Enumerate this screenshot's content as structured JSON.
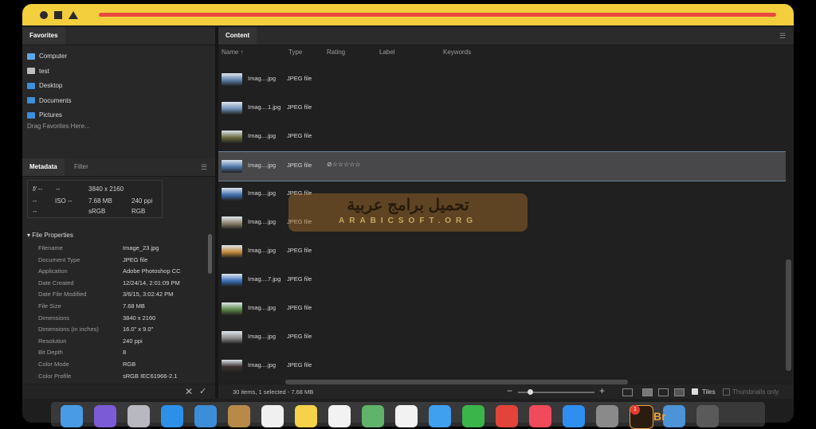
{
  "window": {
    "title_bar_color": "#f3cf3e",
    "title_line_color": "#e84a3f"
  },
  "favorites": {
    "tab": "Favorites",
    "items": [
      {
        "label": "Computer",
        "icon": "computer-icon"
      },
      {
        "label": "test",
        "icon": "home-icon"
      },
      {
        "label": "Desktop",
        "icon": "folder-icon"
      },
      {
        "label": "Documents",
        "icon": "folder-icon"
      },
      {
        "label": "Pictures",
        "icon": "folder-icon"
      }
    ],
    "drag_hint": "Drag Favorites Here..."
  },
  "metadata": {
    "tabs": [
      "Metadata",
      "Filter"
    ],
    "summary": {
      "aperture": "f/ --",
      "shutter": "--",
      "focal": "--",
      "iso": "ISO --",
      "ev": "--",
      "dims": "3840 x 2160",
      "size": "7.68 MB",
      "ppi": "240 ppi",
      "profile": "sRGB",
      "mode": "RGB"
    },
    "section_title": "File Properties",
    "properties": [
      {
        "label": "Filename",
        "value": "Image_23.jpg"
      },
      {
        "label": "Document Type",
        "value": "JPEG file"
      },
      {
        "label": "Application",
        "value": "Adobe Photoshop CC"
      },
      {
        "label": "Date Created",
        "value": "12/24/14, 2:01:09 PM"
      },
      {
        "label": "Date File Modified",
        "value": "3/6/15, 3:02:42 PM"
      },
      {
        "label": "File Size",
        "value": "7.68 MB"
      },
      {
        "label": "Dimensions",
        "value": "3840 x 2160"
      },
      {
        "label": "Dimensions (in inches)",
        "value": "16.0\" x 9.0\""
      },
      {
        "label": "Resolution",
        "value": "240 ppi"
      },
      {
        "label": "Bit Depth",
        "value": "8"
      },
      {
        "label": "Color Mode",
        "value": "RGB"
      },
      {
        "label": "Color Profile",
        "value": "sRGB IEC61966-2.1"
      }
    ],
    "cancel_label": "✕",
    "apply_label": "✓"
  },
  "content": {
    "tab": "Content",
    "columns": {
      "name": "Name ↑",
      "type": "Type",
      "rating": "Rating",
      "label": "Label",
      "keywords": "Keywords"
    },
    "rows": [
      {
        "name": "Imag....jpg",
        "type": "JPEG file",
        "rating": "",
        "thumb": "#5a7fa8"
      },
      {
        "name": "Imag....1.jpg",
        "type": "JPEG file",
        "rating": "",
        "thumb": "#6f8fb5"
      },
      {
        "name": "Imag....jpg",
        "type": "JPEG file",
        "rating": "",
        "thumb": "#6b6a3d"
      },
      {
        "name": "Imag....jpg",
        "type": "JPEG file",
        "rating": "⊘☆☆☆☆☆",
        "thumb": "#4c74a8",
        "selected": true
      },
      {
        "name": "Imag....jpg",
        "type": "JPEG file",
        "rating": "",
        "thumb": "#3f6fb0"
      },
      {
        "name": "Imag....jpg",
        "type": "JPEG file",
        "rating": "",
        "thumb": "#8a7f6a"
      },
      {
        "name": "Imag....jpg",
        "type": "JPEG file",
        "rating": "",
        "thumb": "#c28a3a"
      },
      {
        "name": "Imag....7.jpg",
        "type": "JPEG file",
        "rating": "",
        "thumb": "#3a6eb8"
      },
      {
        "name": "Imag....jpg",
        "type": "JPEG file",
        "rating": "",
        "thumb": "#5e8a4a"
      },
      {
        "name": "Imag....jpg",
        "type": "JPEG file",
        "rating": "",
        "thumb": "#8c8c8c"
      },
      {
        "name": "Imag....jpg",
        "type": "JPEG file",
        "rating": "",
        "thumb": "#3b2f2f"
      }
    ]
  },
  "watermark": {
    "arabic": "تحميل برامج عربية",
    "latin": "ARABICSOFT.ORG"
  },
  "status": {
    "text": "30 items, 1 selected - 7.68 MB",
    "zoom_minus": "−",
    "zoom_plus": "+",
    "zoom_level": 0.12,
    "tiles_label": "Tiles",
    "tiles_checked": true,
    "thumbnails_label": "Thumbnails only"
  },
  "dock": {
    "apps": [
      {
        "name": "finder",
        "color": "#4a9be6"
      },
      {
        "name": "siri",
        "color": "#7b5cd6"
      },
      {
        "name": "launchpad",
        "color": "#b8b8c0"
      },
      {
        "name": "safari",
        "color": "#2c8fe8"
      },
      {
        "name": "mail",
        "color": "#3d8ed8"
      },
      {
        "name": "contacts",
        "color": "#b88a4a"
      },
      {
        "name": "calendar",
        "color": "#f0f0f0"
      },
      {
        "name": "notes",
        "color": "#f6d24a"
      },
      {
        "name": "reminders",
        "color": "#f2f2f2"
      },
      {
        "name": "maps",
        "color": "#5fb36a"
      },
      {
        "name": "photos",
        "color": "#f2f2f2"
      },
      {
        "name": "messages",
        "color": "#3fa0f0"
      },
      {
        "name": "facetime",
        "color": "#3ab54a"
      },
      {
        "name": "news",
        "color": "#e2433a"
      },
      {
        "name": "music",
        "color": "#f14a5a"
      },
      {
        "name": "app-store",
        "color": "#2f8ff0"
      },
      {
        "name": "system-preferences",
        "color": "#8a8a8a"
      },
      {
        "name": "bridge",
        "color": "#2a1d10"
      },
      {
        "name": "downloads-folder",
        "color": "#4c93d8"
      },
      {
        "name": "trash",
        "color": "#5a5a5a"
      }
    ],
    "badge": "1",
    "bridge_label": "Br"
  }
}
